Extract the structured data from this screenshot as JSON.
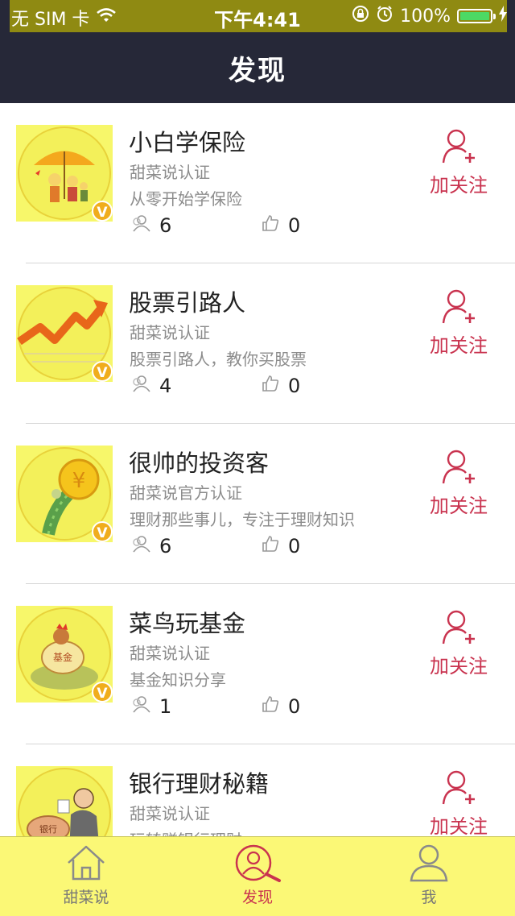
{
  "status_bar": {
    "carrier": "无 SIM 卡",
    "time": "下午4:41",
    "battery": "100%"
  },
  "nav": {
    "title": "发现"
  },
  "follow_label": "加关注",
  "badge": "V",
  "items": [
    {
      "name": "小白学保险",
      "auth": "甜菜说认证",
      "desc": "从零开始学保险",
      "fans": "6",
      "likes": "0"
    },
    {
      "name": "股票引路人",
      "auth": "甜菜说认证",
      "desc": "股票引路人，教你买股票",
      "fans": "4",
      "likes": "0"
    },
    {
      "name": "很帅的投资客",
      "auth": "甜菜说官方认证",
      "desc": "理财那些事儿，专注于理财知识",
      "fans": "6",
      "likes": "0"
    },
    {
      "name": "菜鸟玩基金",
      "auth": "甜菜说认证",
      "desc": "基金知识分享",
      "fans": "1",
      "likes": "0"
    },
    {
      "name": "银行理财秘籍",
      "auth": "甜菜说认证",
      "desc": "玩转赚银行理财",
      "fans": "",
      "likes": ""
    }
  ],
  "avatar_text": {
    "fund": "基金",
    "bank": "银行"
  },
  "tabs": [
    {
      "label": "甜菜说",
      "icon": "home-icon"
    },
    {
      "label": "发现",
      "icon": "discover-icon"
    },
    {
      "label": "我",
      "icon": "profile-icon"
    }
  ],
  "colors": {
    "nav_bg": "#262838",
    "accent": "#c9334f",
    "tabbar_bg": "#fbf876",
    "avatar_bg": "#f7f76a",
    "badge": "#f0ad1c"
  }
}
